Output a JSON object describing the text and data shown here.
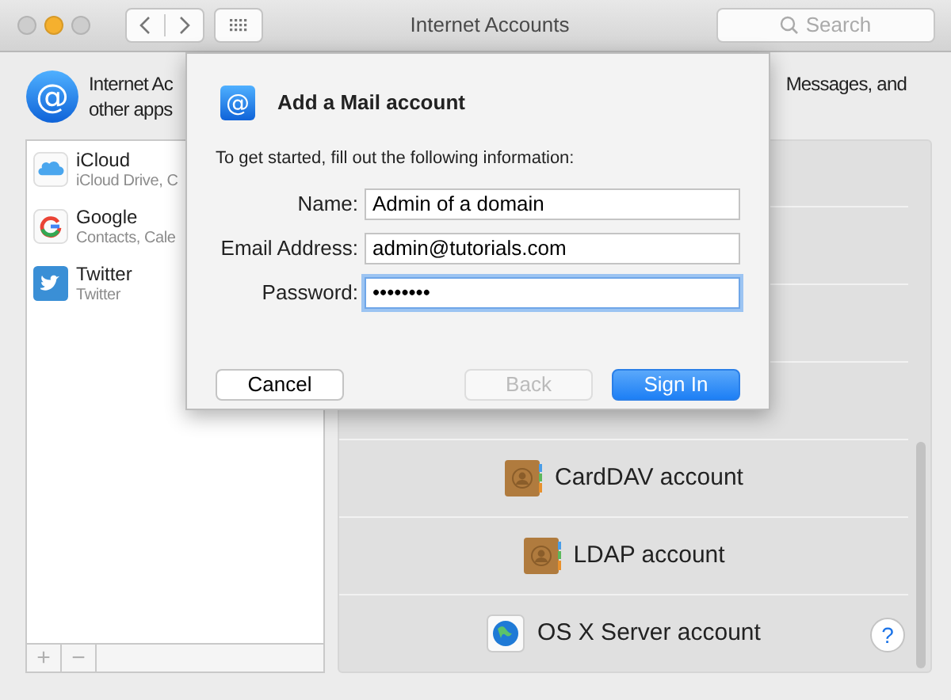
{
  "window": {
    "title": "Internet Accounts",
    "traffic_lights": [
      {
        "color": "#cdcdcd"
      },
      {
        "color": "#f5b02e"
      },
      {
        "color": "#cdcdcd"
      }
    ]
  },
  "search": {
    "placeholder": "Search"
  },
  "header": {
    "icon": "@",
    "left_line_1": "Internet Ac",
    "left_line_2": "other apps",
    "right_line_1": "Messages, and"
  },
  "sidebar": {
    "items": [
      {
        "title": "iCloud",
        "subtitle": "iCloud Drive, C",
        "kind": "icloud"
      },
      {
        "title": "Google",
        "subtitle": "Contacts, Cale",
        "kind": "google"
      },
      {
        "title": "Twitter",
        "subtitle": "Twitter",
        "kind": "twitter"
      }
    ],
    "footer_buttons": [
      {
        "label": "+",
        "disabled": true
      },
      {
        "label": "−",
        "disabled": true
      }
    ]
  },
  "accounts": [
    {
      "label": "CardDAV account",
      "kind": "contacts"
    },
    {
      "label": "LDAP account",
      "kind": "contacts"
    },
    {
      "label": "OS X Server account",
      "kind": "server"
    }
  ],
  "help": "?",
  "dialog": {
    "icon": "@",
    "title": "Add a Mail account",
    "instruction": "To get started, fill out the following information:",
    "fields": [
      {
        "label": "Name:",
        "value": "Admin of a domain",
        "focused": false
      },
      {
        "label": "Email Address:",
        "value": "admin@tutorials.com",
        "focused": false
      },
      {
        "label": "Password:",
        "value": "••••••••",
        "focused": true
      }
    ],
    "buttons": [
      {
        "label": "Cancel",
        "kind": "default",
        "disabled": false
      },
      {
        "label": "Back",
        "kind": "default",
        "disabled": true
      },
      {
        "label": "Sign In",
        "kind": "primary",
        "disabled": false
      }
    ]
  }
}
